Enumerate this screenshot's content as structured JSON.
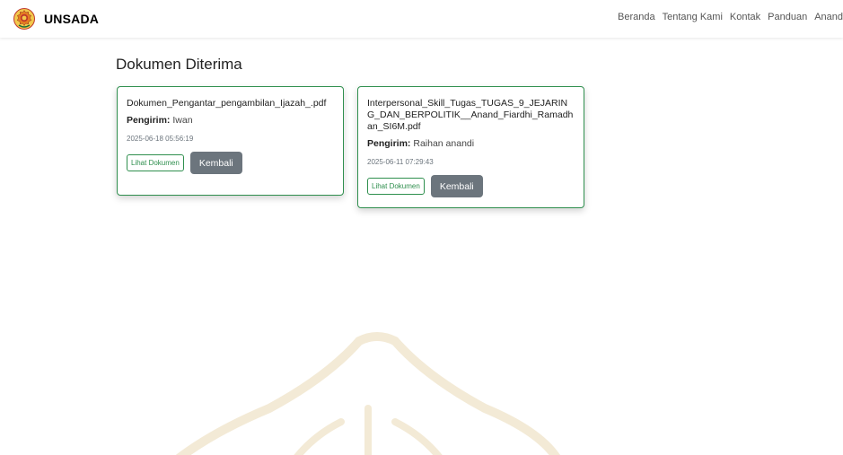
{
  "navbar": {
    "brand": "UNSADA",
    "links": [
      "Beranda",
      "Tentang Kami",
      "Kontak",
      "Panduan",
      "Anand"
    ]
  },
  "main": {
    "title": "Dokumen Diterima",
    "documents": [
      {
        "filename": "Dokumen_Pengantar_pengambilan_Ijazah_.pdf",
        "sender_label": "Pengirim:",
        "sender": "Iwan",
        "date": "2025-06-18 05:56:19",
        "view_label": "Lihat Dokumen",
        "back_label": "Kembali"
      },
      {
        "filename": "Interpersonal_Skill_Tugas_TUGAS_9_JEJARING_DAN_BERPOLITIK__Anand_Fiardhi_Ramadhan_SI6M.pdf",
        "sender_label": "Pengirim:",
        "sender": "Raihan anandi",
        "date": "2025-06-11 07:29:43",
        "view_label": "Lihat Dokumen",
        "back_label": "Kembali"
      }
    ]
  },
  "colors": {
    "accent": "#2f8f4e",
    "secondary_button": "#6c757d",
    "watermark": "#f3ead6"
  },
  "icons": {
    "logo": "university-seal-icon",
    "watermark": "dome-watermark-icon"
  }
}
